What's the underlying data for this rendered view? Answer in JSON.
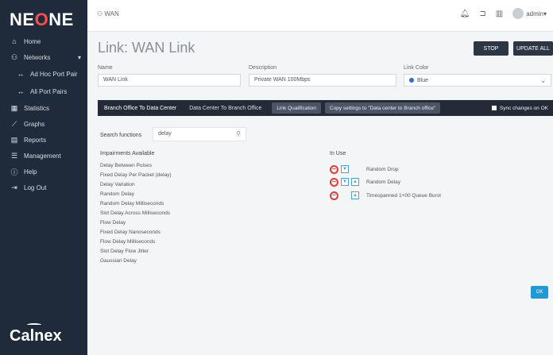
{
  "brand": {
    "logo_prefix": "NE",
    "logo_accent": "O",
    "logo_suffix": "NE",
    "footer": "Calnex"
  },
  "sidebar": {
    "items": [
      {
        "label": "Home",
        "icon": "home-icon"
      },
      {
        "label": "Networks",
        "icon": "network-icon"
      },
      {
        "label": "Ad Hoc Port Pair",
        "icon": "swap-icon"
      },
      {
        "label": "All Port Pairs",
        "icon": "swap-icon"
      },
      {
        "label": "Statistics",
        "icon": "table-icon"
      },
      {
        "label": "Graphs",
        "icon": "chart-icon"
      },
      {
        "label": "Reports",
        "icon": "document-icon"
      },
      {
        "label": "Management",
        "icon": "sliders-icon"
      },
      {
        "label": "Help",
        "icon": "info-icon"
      },
      {
        "label": "Log Out",
        "icon": "logout-icon"
      }
    ]
  },
  "topbar": {
    "breadcrumb": "WAN",
    "user": "admin"
  },
  "page": {
    "title": "Link: WAN Link",
    "stop_label": "STOP",
    "update_all_label": "UPDATE ALL"
  },
  "fields": {
    "name_label": "Name",
    "name_value": "WAN Link",
    "description_label": "Description",
    "description_value": "Private WAN 100Mbps",
    "link_color_label": "Link Color",
    "link_color_value": "Blue"
  },
  "tabs": {
    "tab1": "Branch Office To Data Center",
    "tab2": "Data Center To Branch Office",
    "qualification": "Link Qualification",
    "copy_settings": "Copy settings to \"Data center to Branch office\"",
    "sync_label": "Sync changes on OK"
  },
  "impairments": {
    "search_label": "Search functions",
    "search_value": "delay",
    "available_header": "Impairments Available",
    "available": [
      "Delay Between Pulses",
      "Fixed Delay Per Packet (delay)",
      "Delay Variation",
      "Random Delay",
      "Random Delay Milliseconds",
      "Slot Delay Across Milliseconds",
      "Flow Delay",
      "Fixed Delay Nanoseconds",
      "Flow Delay Milliseconds",
      "Slot Delay Flow Jitter",
      "Gaussian Delay"
    ],
    "in_use_header": "In Use",
    "in_use": [
      {
        "label": "Random Drop",
        "up": false,
        "down": true
      },
      {
        "label": "Random Delay",
        "up": true,
        "down": true
      },
      {
        "label": "Timespanned 1+00 Queue Burst",
        "up": true,
        "down": false
      }
    ]
  },
  "footer_button": "OK",
  "colors": {
    "sidebar_bg": "#1f2a3a",
    "accent": "#1e9ad6",
    "danger": "#e03c3c"
  }
}
